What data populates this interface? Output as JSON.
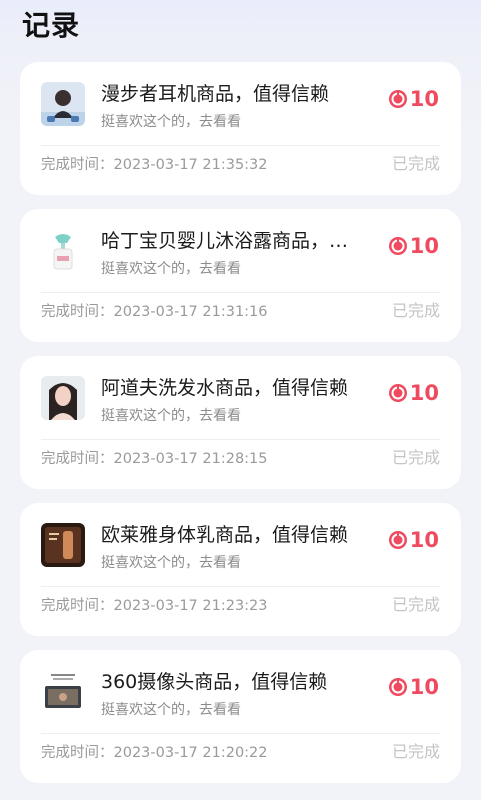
{
  "page": {
    "title": "记录"
  },
  "common": {
    "subtitle": "挺喜欢这个的，去看看",
    "time_label": "完成时间：",
    "status": "已完成",
    "points_color": "#ef4a5f",
    "points_icon": "coin-icon"
  },
  "records": [
    {
      "title": "漫步者耳机商品，值得信赖",
      "points": "10",
      "time": "2023-03-17 21:35:32",
      "thumb": "headphones-product-thumbnail"
    },
    {
      "title": "哈丁宝贝婴儿沐浴露商品，…",
      "points": "10",
      "time": "2023-03-17 21:31:16",
      "thumb": "body-wash-bottle-thumbnail"
    },
    {
      "title": "阿道夫洗发水商品，值得信赖",
      "points": "10",
      "time": "2023-03-17 21:28:15",
      "thumb": "shampoo-model-thumbnail"
    },
    {
      "title": "欧莱雅身体乳商品，值得信赖",
      "points": "10",
      "time": "2023-03-17 21:23:23",
      "thumb": "body-lotion-thumbnail"
    },
    {
      "title": "360摄像头商品，值得信赖",
      "points": "10",
      "time": "2023-03-17 21:20:22",
      "thumb": "camera-product-thumbnail"
    }
  ]
}
